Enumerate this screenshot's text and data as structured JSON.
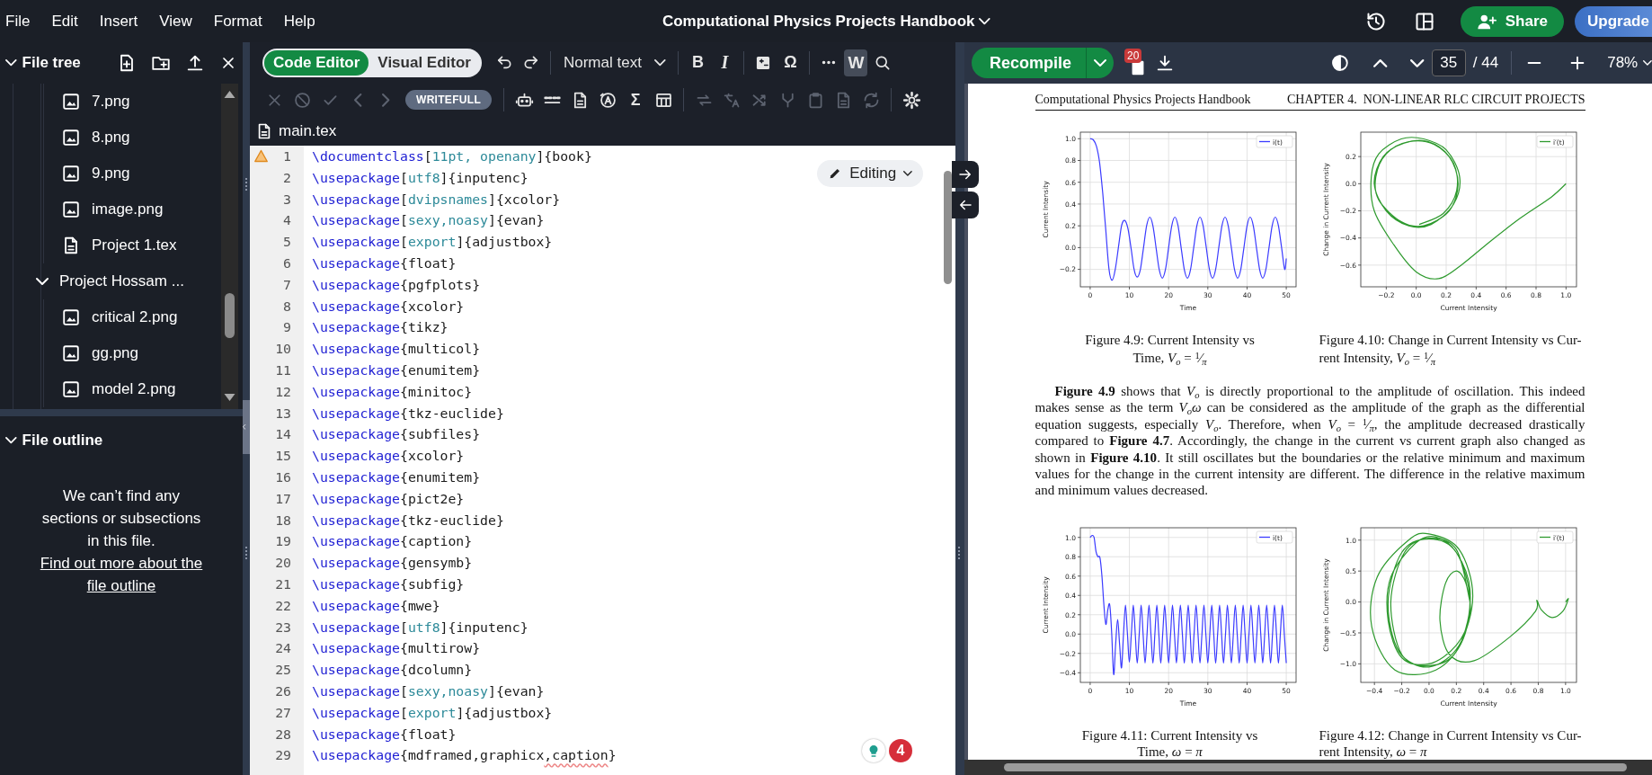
{
  "menubar": {
    "menus": [
      "File",
      "Edit",
      "Insert",
      "View",
      "Format",
      "Help"
    ],
    "title": "Computational Physics Projects Handbook",
    "share": "Share",
    "upgrade": "Upgrade"
  },
  "file_tree": {
    "title": "File tree",
    "items": [
      {
        "children": [
          {
            "name": "7.png",
            "kind": "image"
          },
          {
            "name": "8.png",
            "kind": "image"
          },
          {
            "name": "9.png",
            "kind": "image"
          },
          {
            "name": "image.png",
            "kind": "image"
          },
          {
            "name": "Project 1.tex",
            "kind": "document"
          }
        ]
      },
      {
        "name": "Project Hossam ...",
        "kind": "folder",
        "expanded": true,
        "children": [
          {
            "name": "critical 2.png",
            "kind": "image"
          },
          {
            "name": "gg.png",
            "kind": "image"
          },
          {
            "name": "model 2.png",
            "kind": "image"
          }
        ]
      }
    ]
  },
  "file_outline": {
    "title": "File outline",
    "expanded": true,
    "message": "We can’t find any sections or subsections in this file.",
    "link": "Find out more about the file outline"
  },
  "editor": {
    "modes": [
      {
        "label": "Code Editor",
        "selected": true
      },
      {
        "label": "Visual Editor",
        "selected": false
      }
    ],
    "toolbar_top": [
      {
        "kind": "undo",
        "highlighted": false
      },
      {
        "kind": "redo",
        "highlighted": false
      },
      {
        "kind": "separator"
      },
      {
        "kind": "style",
        "label": "Normal text",
        "highlighted": false
      },
      {
        "kind": "separator"
      },
      {
        "kind": "bold",
        "label": "B",
        "highlighted": false
      },
      {
        "kind": "italic",
        "label": "I",
        "highlighted": false
      },
      {
        "kind": "separator"
      },
      {
        "kind": "math",
        "highlighted": false
      },
      {
        "kind": "symbol",
        "label": "Ω",
        "highlighted": false
      },
      {
        "kind": "separator"
      },
      {
        "kind": "more",
        "highlighted": false
      },
      {
        "kind": "writefull",
        "label": "W",
        "highlighted": true
      },
      {
        "kind": "search",
        "highlighted": false
      }
    ],
    "toolbar_bottom": [
      {
        "kind": "close",
        "disabled": true
      },
      {
        "kind": "ban",
        "disabled": true
      },
      {
        "kind": "check",
        "disabled": true
      },
      {
        "kind": "prev",
        "disabled": true
      },
      {
        "kind": "next",
        "disabled": true
      },
      {
        "kind": "badge",
        "label": "WRITEFULL",
        "disabled": false
      },
      {
        "kind": "separator"
      },
      {
        "kind": "robot",
        "disabled": false
      },
      {
        "kind": "dots",
        "disabled": false
      },
      {
        "kind": "document",
        "disabled": false
      },
      {
        "kind": "circle",
        "disabled": false
      },
      {
        "kind": "sum",
        "label": "Σ",
        "disabled": false
      },
      {
        "kind": "table",
        "disabled": false
      },
      {
        "kind": "separator"
      },
      {
        "kind": "swap",
        "disabled": true
      },
      {
        "kind": "translate",
        "disabled": true
      },
      {
        "kind": "shuffle",
        "disabled": true
      },
      {
        "kind": "merge",
        "disabled": true
      },
      {
        "kind": "clipboard",
        "disabled": true
      },
      {
        "kind": "document",
        "disabled": true
      },
      {
        "kind": "refresh",
        "disabled": true
      },
      {
        "kind": "separator"
      },
      {
        "kind": "settings",
        "disabled": false
      }
    ],
    "file_tab": "main.tex",
    "mode_menu": "Editing",
    "assist_count": "4",
    "lines": [
      {
        "number": "1",
        "warning": true,
        "parts": [
          {
            "kind": "cmd",
            "text": "\\documentclass"
          },
          {
            "kind": "text",
            "text": "["
          },
          {
            "kind": "opt",
            "text": "11pt, openany"
          },
          {
            "kind": "text",
            "text": "]{book}"
          }
        ]
      },
      {
        "number": "2",
        "warning": false,
        "parts": [
          {
            "kind": "cmd",
            "text": "\\usepackage"
          },
          {
            "kind": "text",
            "text": "["
          },
          {
            "kind": "opt",
            "text": "utf8"
          },
          {
            "kind": "text",
            "text": "]{inputenc}"
          }
        ]
      },
      {
        "number": "3",
        "warning": false,
        "parts": [
          {
            "kind": "cmd",
            "text": "\\usepackage"
          },
          {
            "kind": "text",
            "text": "["
          },
          {
            "kind": "opt",
            "text": "dvipsnames"
          },
          {
            "kind": "text",
            "text": "]{xcolor}"
          }
        ]
      },
      {
        "number": "4",
        "warning": false,
        "parts": [
          {
            "kind": "cmd",
            "text": "\\usepackage"
          },
          {
            "kind": "text",
            "text": "["
          },
          {
            "kind": "opt",
            "text": "sexy,noasy"
          },
          {
            "kind": "text",
            "text": "]{evan}"
          }
        ]
      },
      {
        "number": "5",
        "warning": false,
        "parts": [
          {
            "kind": "cmd",
            "text": "\\usepackage"
          },
          {
            "kind": "text",
            "text": "["
          },
          {
            "kind": "opt",
            "text": "export"
          },
          {
            "kind": "text",
            "text": "]{adjustbox}"
          }
        ]
      },
      {
        "number": "6",
        "warning": false,
        "parts": [
          {
            "kind": "cmd",
            "text": "\\usepackage"
          },
          {
            "kind": "text",
            "text": "{float}"
          }
        ]
      },
      {
        "number": "7",
        "warning": false,
        "parts": [
          {
            "kind": "cmd",
            "text": "\\usepackage"
          },
          {
            "kind": "text",
            "text": "{pgfplots}"
          }
        ]
      },
      {
        "number": "8",
        "warning": false,
        "parts": [
          {
            "kind": "cmd",
            "text": "\\usepackage"
          },
          {
            "kind": "text",
            "text": "{xcolor}"
          }
        ]
      },
      {
        "number": "9",
        "warning": false,
        "parts": [
          {
            "kind": "cmd",
            "text": "\\usepackage"
          },
          {
            "kind": "text",
            "text": "{tikz}"
          }
        ]
      },
      {
        "number": "10",
        "warning": false,
        "parts": [
          {
            "kind": "cmd",
            "text": "\\usepackage"
          },
          {
            "kind": "text",
            "text": "{multicol}"
          }
        ]
      },
      {
        "number": "11",
        "warning": false,
        "parts": [
          {
            "kind": "cmd",
            "text": "\\usepackage"
          },
          {
            "kind": "text",
            "text": "{enumitem}"
          }
        ]
      },
      {
        "number": "12",
        "warning": false,
        "parts": [
          {
            "kind": "cmd",
            "text": "\\usepackage"
          },
          {
            "kind": "text",
            "text": "{minitoc}"
          }
        ]
      },
      {
        "number": "13",
        "warning": false,
        "parts": [
          {
            "kind": "cmd",
            "text": "\\usepackage"
          },
          {
            "kind": "text",
            "text": "{tkz-euclide}"
          }
        ]
      },
      {
        "number": "14",
        "warning": false,
        "parts": [
          {
            "kind": "cmd",
            "text": "\\usepackage"
          },
          {
            "kind": "text",
            "text": "{subfiles}"
          }
        ]
      },
      {
        "number": "15",
        "warning": false,
        "parts": [
          {
            "kind": "cmd",
            "text": "\\usepackage"
          },
          {
            "kind": "text",
            "text": "{xcolor}"
          }
        ]
      },
      {
        "number": "16",
        "warning": false,
        "parts": [
          {
            "kind": "cmd",
            "text": "\\usepackage"
          },
          {
            "kind": "text",
            "text": "{enumitem}"
          }
        ]
      },
      {
        "number": "17",
        "warning": false,
        "parts": [
          {
            "kind": "cmd",
            "text": "\\usepackage"
          },
          {
            "kind": "text",
            "text": "{pict2e}"
          }
        ]
      },
      {
        "number": "18",
        "warning": false,
        "parts": [
          {
            "kind": "cmd",
            "text": "\\usepackage"
          },
          {
            "kind": "text",
            "text": "{tkz-euclide}"
          }
        ]
      },
      {
        "number": "19",
        "warning": false,
        "parts": [
          {
            "kind": "cmd",
            "text": "\\usepackage"
          },
          {
            "kind": "text",
            "text": "{caption}"
          }
        ]
      },
      {
        "number": "20",
        "warning": false,
        "parts": [
          {
            "kind": "cmd",
            "text": "\\usepackage"
          },
          {
            "kind": "text",
            "text": "{gensymb}"
          }
        ]
      },
      {
        "number": "21",
        "warning": false,
        "parts": [
          {
            "kind": "cmd",
            "text": "\\usepackage"
          },
          {
            "kind": "text",
            "text": "{subfig}"
          }
        ]
      },
      {
        "number": "22",
        "warning": false,
        "parts": [
          {
            "kind": "cmd",
            "text": "\\usepackage"
          },
          {
            "kind": "text",
            "text": "{mwe}"
          }
        ]
      },
      {
        "number": "23",
        "warning": false,
        "parts": [
          {
            "kind": "cmd",
            "text": "\\usepackage"
          },
          {
            "kind": "text",
            "text": "["
          },
          {
            "kind": "opt",
            "text": "utf8"
          },
          {
            "kind": "text",
            "text": "]{inputenc}"
          }
        ]
      },
      {
        "number": "24",
        "warning": false,
        "parts": [
          {
            "kind": "cmd",
            "text": "\\usepackage"
          },
          {
            "kind": "text",
            "text": "{multirow}"
          }
        ]
      },
      {
        "number": "25",
        "warning": false,
        "parts": [
          {
            "kind": "cmd",
            "text": "\\usepackage"
          },
          {
            "kind": "text",
            "text": "{dcolumn}"
          }
        ]
      },
      {
        "number": "26",
        "warning": false,
        "parts": [
          {
            "kind": "cmd",
            "text": "\\usepackage"
          },
          {
            "kind": "text",
            "text": "["
          },
          {
            "kind": "opt",
            "text": "sexy,noasy"
          },
          {
            "kind": "text",
            "text": "]{evan}"
          }
        ]
      },
      {
        "number": "27",
        "warning": false,
        "parts": [
          {
            "kind": "cmd",
            "text": "\\usepackage"
          },
          {
            "kind": "text",
            "text": "["
          },
          {
            "kind": "opt",
            "text": "export"
          },
          {
            "kind": "text",
            "text": "]{adjustbox}"
          }
        ]
      },
      {
        "number": "28",
        "warning": false,
        "parts": [
          {
            "kind": "cmd",
            "text": "\\usepackage"
          },
          {
            "kind": "text",
            "text": "{float}"
          }
        ]
      },
      {
        "number": "29",
        "warning": false,
        "parts": [
          {
            "kind": "cmd",
            "text": "\\usepackage"
          },
          {
            "kind": "text",
            "text": "{mdframed,graphicx"
          },
          {
            "kind": "flag",
            "text": ",caption"
          },
          {
            "kind": "text",
            "text": "}"
          }
        ]
      }
    ]
  },
  "pdf": {
    "recompile": "Recompile",
    "log_count": "20",
    "page": "35",
    "page_total": "/ 44",
    "zoom": "78%",
    "header_left": "Computational Physics Projects Handbook",
    "header_right": "CHAPTER 4.  NON-LINEAR RLC CIRCUIT PROJECTS",
    "blocks": [
      {
        "kind": "figures",
        "figures": [
          {
            "caption": [
              "Figure 4.9: Current Intensity vs",
              "Time, *V*$_{o}$ = $^{1}$⁄$_{π}$"
            ],
            "chart_data": {
              "type": "line",
              "grid": true,
              "xlabel": "Time",
              "ylabel": "Current Intensity",
              "xlim": [
                -2.5,
                52.5
              ],
              "ylim": [
                -0.36,
                1.06
              ],
              "xticks": [
                0,
                10,
                20,
                30,
                40,
                50
              ],
              "yticks": [
                {
                  "value": -0.2,
                  "label": "−0.2"
                },
                {
                  "value": 0,
                  "label": "0.0"
                },
                {
                  "value": 0.2,
                  "label": "0.2"
                },
                {
                  "value": 0.4,
                  "label": "0.4"
                },
                {
                  "value": 0.6,
                  "label": "0.6"
                },
                {
                  "value": 0.8,
                  "label": "0.8"
                },
                {
                  "value": 1,
                  "label": "1.0"
                }
              ],
              "x": [
                0,
                0.8,
                1.6,
                2.4,
                3.2,
                4,
                4.8,
                5.6,
                6.4,
                7.2,
                8,
                8.8,
                9.6,
                10.4,
                11.2,
                12,
                12.8,
                13.6,
                14.4,
                15.2,
                16,
                16.8,
                17.6,
                18.4,
                19.2,
                20,
                20.8,
                21.6,
                22.4,
                23.2,
                24,
                24.8,
                25.6,
                26.4,
                27.2,
                28,
                28.8,
                29.6,
                30.4,
                31.2,
                32,
                32.8,
                33.6,
                34.4,
                35.2,
                36,
                36.8,
                37.6,
                38.4,
                39.2,
                40,
                40.8,
                41.6,
                42.4,
                43.2,
                44,
                44.8,
                45.6,
                46.4,
                47.2,
                48,
                48.8,
                49.6,
                50
              ],
              "series": [
                {
                  "name": "i(t)",
                  "color": "#3b3bff",
                  "values": [
                    1.0,
                    0.99,
                    0.93,
                    0.78,
                    0.5,
                    0.15,
                    -0.2,
                    -0.3,
                    -0.2,
                    0.0,
                    0.2,
                    0.25,
                    0.18,
                    0.0,
                    -0.2,
                    -0.27,
                    -0.2,
                    0,
                    0.2,
                    0.28,
                    0.2,
                    0,
                    -0.2,
                    -0.28,
                    -0.2,
                    0,
                    0.2,
                    0.28,
                    0.2,
                    0,
                    -0.2,
                    -0.28,
                    -0.2,
                    0,
                    0.2,
                    0.28,
                    0.2,
                    0,
                    -0.2,
                    -0.28,
                    -0.2,
                    0,
                    0.2,
                    0.28,
                    0.2,
                    0,
                    -0.2,
                    -0.28,
                    -0.2,
                    0,
                    0.2,
                    0.28,
                    0.2,
                    0,
                    -0.2,
                    -0.28,
                    -0.2,
                    0,
                    0.2,
                    0.28,
                    0.2,
                    0,
                    -0.2,
                    -0.1
                  ]
                }
              ]
            }
          },
          {
            "caption": [
              "Figure 4.10: Change in Current Intensity vs Cur-",
              "rent Intensity, *V*$_{o}$ = $^{1}$⁄$_{π}$"
            ],
            "chart_data": {
              "type": "line",
              "grid": true,
              "xlabel": "Current Intensity",
              "ylabel": "Change in Current Intensity",
              "xlim": [
                -0.37,
                1.07
              ],
              "ylim": [
                -0.76,
                0.38
              ],
              "xticks": [
                {
                  "value": -0.2,
                  "label": "−0.2"
                },
                {
                  "value": 0,
                  "label": "0.0"
                },
                {
                  "value": 0.2,
                  "label": "0.2"
                },
                {
                  "value": 0.4,
                  "label": "0.4"
                },
                {
                  "value": 0.6,
                  "label": "0.6"
                },
                {
                  "value": 0.8,
                  "label": "0.8"
                },
                {
                  "value": 1,
                  "label": "1.0"
                }
              ],
              "yticks": [
                {
                  "value": -0.6,
                  "label": "−0.6"
                },
                {
                  "value": -0.4,
                  "label": "−0.4"
                },
                {
                  "value": -0.2,
                  "label": "−0.2"
                },
                {
                  "value": 0,
                  "label": "0.0"
                },
                {
                  "value": 0.2,
                  "label": "0.2"
                }
              ],
              "x": [
                1.0,
                0.9,
                0.7,
                0.5,
                0.3,
                0.15,
                0.0,
                -0.15,
                -0.28,
                -0.3,
                -0.25,
                -0.1,
                0.05,
                0.2,
                0.29,
                0.25,
                0.1,
                -0.05,
                -0.2,
                -0.28,
                -0.22,
                -0.08,
                0.08,
                0.22,
                0.28,
                0.22,
                0.05,
                -0.1,
                -0.25,
                -0.27,
                -0.2,
                -0.05,
                0.12,
                0.25,
                0.27,
                0.18,
                0.02
              ],
              "series": [
                {
                  "name": "i′(t)",
                  "color": "#2e9a2e",
                  "values": [
                    0.0,
                    -0.1,
                    -0.25,
                    -0.42,
                    -0.6,
                    -0.7,
                    -0.65,
                    -0.45,
                    -0.2,
                    0.05,
                    0.22,
                    0.33,
                    0.33,
                    0.25,
                    0.05,
                    -0.15,
                    -0.3,
                    -0.31,
                    -0.2,
                    0.0,
                    0.2,
                    0.3,
                    0.31,
                    0.2,
                    0.0,
                    -0.2,
                    -0.31,
                    -0.28,
                    -0.12,
                    0.05,
                    0.22,
                    0.31,
                    0.29,
                    0.15,
                    -0.05,
                    -0.22,
                    -0.3
                  ]
                }
              ]
            }
          }
        ]
      },
      {
        "kind": "paragraph",
        "text": "**Figure 4.9** shows that *V*$_{o}$ is directly proportional to the amplitude of oscillation. This indeed makes sense as the term *V*$_{o}$*ω* can be considered as the amplitude of the graph as the differential equation suggests, especially *V*$_{o}$. Therefore, when *V*$_{o}$ = $^{1}$⁄$_{π}$, the amplitude decreased drastically compared to **Figure 4.7**. Accordingly, the change in the current vs current graph also changed as shown in **Figure 4.10**. It still oscillates but the boundaries or the relative minimum and maximum values for the change in the current intensity are different. The difference in the relative maximum and minimum values decreased."
      },
      {
        "kind": "figures",
        "figures": [
          {
            "caption": [
              "Figure 4.11: Current Intensity vs",
              "Time, *ω* = *π*"
            ],
            "chart_data": {
              "type": "line",
              "grid": true,
              "xlabel": "Time",
              "ylabel": "Current Intensity",
              "xlim": [
                -2.5,
                52.5
              ],
              "ylim": [
                -0.5,
                1.1
              ],
              "xticks": [
                0,
                10,
                20,
                30,
                40,
                50
              ],
              "yticks": [
                {
                  "value": -0.4,
                  "label": "−0.4"
                },
                {
                  "value": -0.2,
                  "label": "−0.2"
                },
                {
                  "value": 0,
                  "label": "0.0"
                },
                {
                  "value": 0.2,
                  "label": "0.2"
                },
                {
                  "value": 0.4,
                  "label": "0.4"
                },
                {
                  "value": 0.6,
                  "label": "0.6"
                },
                {
                  "value": 0.8,
                  "label": "0.8"
                },
                {
                  "value": 1,
                  "label": "1.0"
                }
              ],
              "x": [
                0,
                0.5,
                1,
                1.5,
                2,
                2.5,
                3,
                3.5,
                4,
                4.5,
                5,
                5.5,
                6,
                6.5,
                7,
                7.5,
                8,
                8.5,
                9,
                9.5,
                10,
                10.5,
                11,
                11.5,
                12,
                12.5,
                13,
                13.5,
                14,
                14.5,
                15,
                15.5,
                16,
                16.5,
                17,
                17.5,
                18,
                18.5,
                19,
                19.5,
                20,
                20.5,
                21,
                21.5,
                22,
                22.5,
                23,
                23.5,
                24,
                24.5,
                25,
                25.5,
                26,
                26.5,
                27,
                27.5,
                28,
                28.5,
                29,
                29.5,
                30,
                30.5,
                31,
                31.5,
                32,
                32.5,
                33,
                33.5,
                34,
                34.5,
                35,
                35.5,
                36,
                36.5,
                37,
                37.5,
                38,
                38.5,
                39,
                39.5,
                40,
                40.5,
                41,
                41.5,
                42,
                42.5,
                43,
                43.5,
                44,
                44.5,
                45,
                45.5,
                46,
                46.5,
                47,
                47.5,
                48,
                48.5,
                49,
                49.5,
                50
              ],
              "series": [
                {
                  "name": "i(t)",
                  "color": "#3b3bff",
                  "values": [
                    1.0,
                    1.02,
                    1.0,
                    0.85,
                    0.8,
                    0.79,
                    0.6,
                    0.3,
                    0.1,
                    0.25,
                    0.3,
                    0.0,
                    -0.42,
                    -0.1,
                    0.15,
                    -0.1,
                    -0.35,
                    0.0,
                    0.3,
                    0.0,
                    -0.29,
                    0,
                    0.3,
                    0,
                    -0.3,
                    0,
                    0.3,
                    0,
                    -0.3,
                    0,
                    0.3,
                    0,
                    -0.3,
                    0,
                    0.3,
                    0,
                    -0.3,
                    0,
                    0.3,
                    0,
                    -0.3,
                    0,
                    0.3,
                    0,
                    -0.3,
                    0,
                    0.3,
                    0,
                    -0.3,
                    0,
                    0.3,
                    0,
                    -0.3,
                    0,
                    0.3,
                    0,
                    -0.3,
                    0,
                    0.3,
                    0,
                    -0.3,
                    0,
                    0.3,
                    0,
                    -0.3,
                    0,
                    0.3,
                    0,
                    -0.3,
                    0,
                    0.3,
                    0,
                    -0.3,
                    0,
                    0.3,
                    0,
                    -0.3,
                    0,
                    0.3,
                    0,
                    -0.3,
                    0,
                    0.3,
                    0,
                    -0.3,
                    0,
                    0.3,
                    0,
                    -0.3,
                    0,
                    0.3,
                    0,
                    -0.3,
                    0,
                    0.3,
                    0,
                    -0.3,
                    0,
                    0.3,
                    0,
                    -0.3
                  ]
                }
              ]
            }
          },
          {
            "caption": [
              "Figure 4.12: Change in Current Intensity vs Cur-",
              "rent Intensity, *ω* = *π*"
            ],
            "chart_data": {
              "type": "line",
              "grid": true,
              "xlabel": "Current Intensity",
              "ylabel": "Change in Current Intensity",
              "xlim": [
                -0.5,
                1.08
              ],
              "ylim": [
                -1.3,
                1.2
              ],
              "xticks": [
                {
                  "value": -0.4,
                  "label": "−0.4"
                },
                {
                  "value": -0.2,
                  "label": "−0.2"
                },
                {
                  "value": 0,
                  "label": "0.0"
                },
                {
                  "value": 0.2,
                  "label": "0.2"
                },
                {
                  "value": 0.4,
                  "label": "0.4"
                },
                {
                  "value": 0.6,
                  "label": "0.6"
                },
                {
                  "value": 0.8,
                  "label": "0.8"
                },
                {
                  "value": 1,
                  "label": "1.0"
                }
              ],
              "yticks": [
                {
                  "value": -1,
                  "label": "−1.0"
                },
                {
                  "value": -0.5,
                  "label": "−0.5"
                },
                {
                  "value": 0,
                  "label": "0.0"
                },
                {
                  "value": 0.5,
                  "label": "0.5"
                },
                {
                  "value": 1,
                  "label": "1.0"
                }
              ],
              "x": [
                1.0,
                1.02,
                0.98,
                0.9,
                0.82,
                0.79,
                0.78,
                0.6,
                0.33,
                0.15,
                0.08,
                0.12,
                0.2,
                0.27,
                0.3,
                0.2,
                0.0,
                -0.2,
                -0.3,
                -0.28,
                -0.1,
                0.05,
                0.2,
                0.3,
                0.25,
                0.05,
                -0.25,
                -0.42,
                -0.38,
                -0.15,
                0.0,
                0.22,
                0.32,
                0.22,
                0.0,
                -0.22,
                -0.3,
                -0.2,
                0.0,
                0.2,
                0.3,
                0.2,
                0.0,
                -0.2,
                -0.28,
                -0.18,
                0.0,
                0.2,
                0.3
              ],
              "series": [
                {
                  "name": "i′(t)",
                  "color": "#2e9a2e",
                  "values": [
                    0.0,
                    0.05,
                    -0.15,
                    -0.25,
                    -0.12,
                    0.03,
                    -0.15,
                    -0.55,
                    -0.95,
                    -0.85,
                    -0.3,
                    0.3,
                    0.5,
                    0.3,
                    -0.2,
                    -0.7,
                    -1.0,
                    -0.9,
                    -0.3,
                    0.4,
                    0.95,
                    1.05,
                    0.8,
                    0.2,
                    -0.6,
                    -1.1,
                    -1.1,
                    -0.4,
                    0.4,
                    1.0,
                    1.1,
                    0.85,
                    0.1,
                    -0.7,
                    -1.05,
                    -0.8,
                    0.0,
                    0.8,
                    1.02,
                    0.8,
                    0.0,
                    -0.8,
                    -1.03,
                    -0.85,
                    0.0,
                    0.8,
                    1.03,
                    0.85,
                    0.0
                  ]
                }
              ]
            }
          }
        ]
      }
    ]
  }
}
